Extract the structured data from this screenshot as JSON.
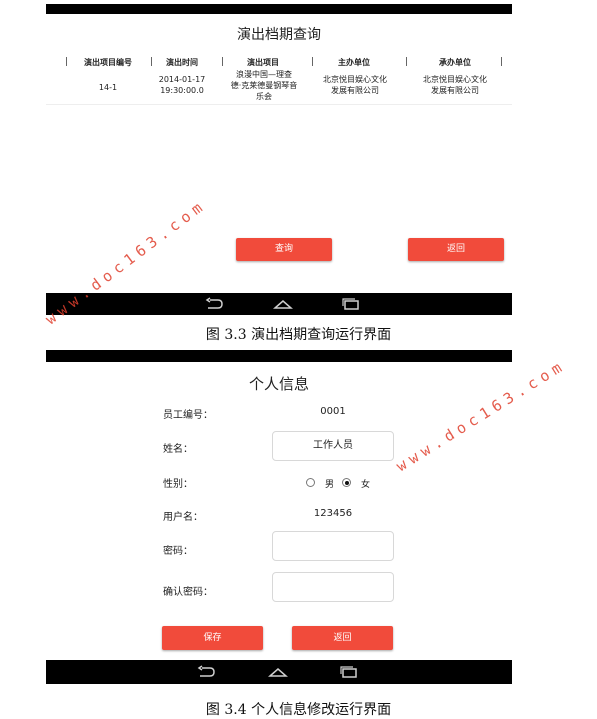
{
  "screen1": {
    "title": "演出档期查询",
    "headers": [
      "演出项目编号",
      "演出时间",
      "演出项目",
      "主办单位",
      "承办单位"
    ],
    "separator": "|",
    "row": {
      "code": "14-1",
      "time": [
        "2014-01-17",
        "19:30:00.0"
      ],
      "project": [
        "浪漫中国—理查",
        "德·克莱德曼钢琴音",
        "乐会"
      ],
      "organizer": [
        "北京悦目娱心文化",
        "发展有限公司"
      ],
      "undertaker": [
        "北京悦目娱心文化",
        "发展有限公司"
      ]
    },
    "query_button": "查询",
    "back_button": "返回"
  },
  "caption1": "图 3.3 演出档期查询运行界面",
  "screen2": {
    "title": "个人信息",
    "employee_id_label": "员工编号：",
    "employee_id_value": "0001",
    "name_label": "姓名：",
    "name_value": "工作人员",
    "gender_label": "性别：",
    "gender_options": [
      "男",
      "女"
    ],
    "gender_selected": "女",
    "username_label": "用户名：",
    "username_value": "123456",
    "password_label": "密码：",
    "password_value": "",
    "confirm_label": "确认密码：",
    "confirm_value": "",
    "save_button": "保存",
    "back_button": "返回"
  },
  "caption2": "图 3.4 个人信息修改运行界面",
  "watermark": "www.doc163.com",
  "colors": {
    "accent": "#f14b3b",
    "watermark": "#e0402e",
    "bar": "#000000"
  },
  "icons": [
    "back-nav-icon",
    "home-nav-icon",
    "recents-nav-icon"
  ]
}
